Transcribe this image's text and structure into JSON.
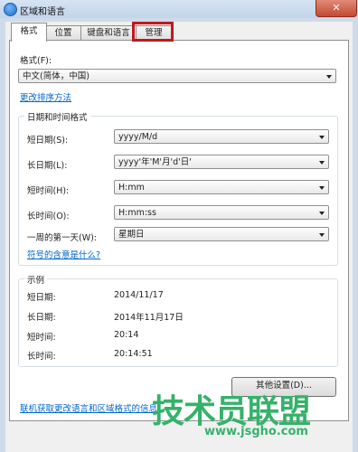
{
  "window": {
    "title": "区域和语言"
  },
  "tabs": [
    {
      "label": "格式"
    },
    {
      "label": "位置"
    },
    {
      "label": "键盘和语言"
    },
    {
      "label": "管理"
    }
  ],
  "format": {
    "label": "格式(F):",
    "value": "中文(简体，中国)",
    "sort_link": "更改排序方法"
  },
  "datetime": {
    "group_title": "日期和时间格式",
    "short_date": {
      "label": "短日期(S):",
      "value": "yyyy/M/d"
    },
    "long_date": {
      "label": "长日期(L):",
      "value": "yyyy'年'M'月'd'日'"
    },
    "short_time": {
      "label": "短时间(H):",
      "value": "H:mm"
    },
    "long_time": {
      "label": "长时间(O):",
      "value": "H:mm:ss"
    },
    "first_day": {
      "label": "一周的第一天(W):",
      "value": "星期日"
    },
    "notation_link": "符号的含意是什么?"
  },
  "examples": {
    "group_title": "示例",
    "rows": [
      {
        "label": "短日期:",
        "value": "2014/11/17"
      },
      {
        "label": "长日期:",
        "value": "2014年11月17日"
      },
      {
        "label": "短时间:",
        "value": "20:14"
      },
      {
        "label": "长时间:",
        "value": "20:14:51"
      }
    ]
  },
  "buttons": {
    "other_settings": "其他设置(D)..."
  },
  "footer": {
    "online_link": "联机获取更改语言和区域格式的信息"
  },
  "watermark": {
    "main": "技术员联盟",
    "url": "www.jsgho.com"
  },
  "colors": {
    "annotation": "#c0191e",
    "link": "#0066cc",
    "watermark": "#35b26a"
  }
}
